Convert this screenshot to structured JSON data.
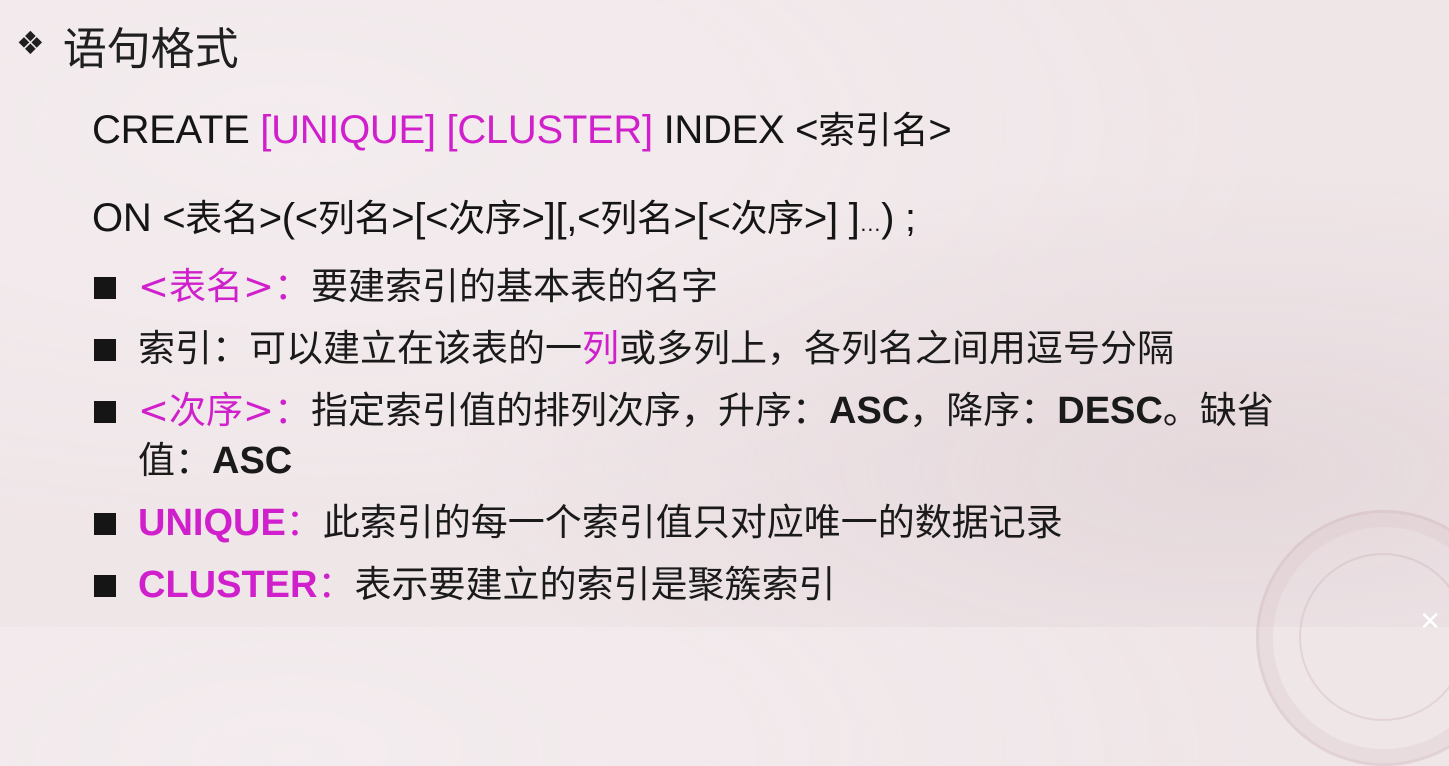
{
  "heading": {
    "marker": "❖",
    "text": "语句格式"
  },
  "syntax": {
    "line1": {
      "kw1": "CREATE ",
      "opt_unique": "[UNIQUE]",
      "opt_cluster": "[CLUSTER]",
      "kw2": " INDEX ",
      "lt": "<",
      "index_name": "索引名",
      "gt": ">"
    },
    "line2": {
      "kw": "ON ",
      "p1": "<",
      "table_name": "表名",
      "p2": ">(<",
      "col1": "列名",
      "p3": ">[<",
      "order1": "次序",
      "p4": ">][,<",
      "col2": "列名",
      "p5": ">[<",
      "order2": "次序",
      "p6": ">] ]",
      "ellipsis": "…",
      "p7": ") ;"
    }
  },
  "bullets": [
    {
      "term": "<表名>",
      "colon": "：",
      "desc": "要建索引的基本表的名字"
    },
    {
      "lead": "索引：可以建立在该表的一",
      "highlight": "列",
      "rest": "或多列上，各列名之间用逗号分隔"
    },
    {
      "term": "<次序>",
      "colon": "：",
      "desc_a": "指定索引值的排列次序，升序：",
      "asc": "ASC",
      "desc_b": "，降序：",
      "desc_kw": "DESC",
      "desc_c": "。缺省",
      "line2_a": "值：",
      "line2_b": "ASC"
    },
    {
      "term": "UNIQUE",
      "colon": "：",
      "desc": "此索引的每一个索引值只对应唯一的数据记录"
    },
    {
      "term": "CLUSTER",
      "colon": "：",
      "desc": "表示要建立的索引是聚簇索引"
    }
  ],
  "colors": {
    "accent": "#d020cc",
    "text": "#151515",
    "background": "#efe6e8"
  },
  "icons": {
    "heading_marker": "diamond-bullet-icon",
    "list_marker": "square-bullet-icon",
    "corner": "close-icon"
  },
  "corner_glyph": "✕"
}
